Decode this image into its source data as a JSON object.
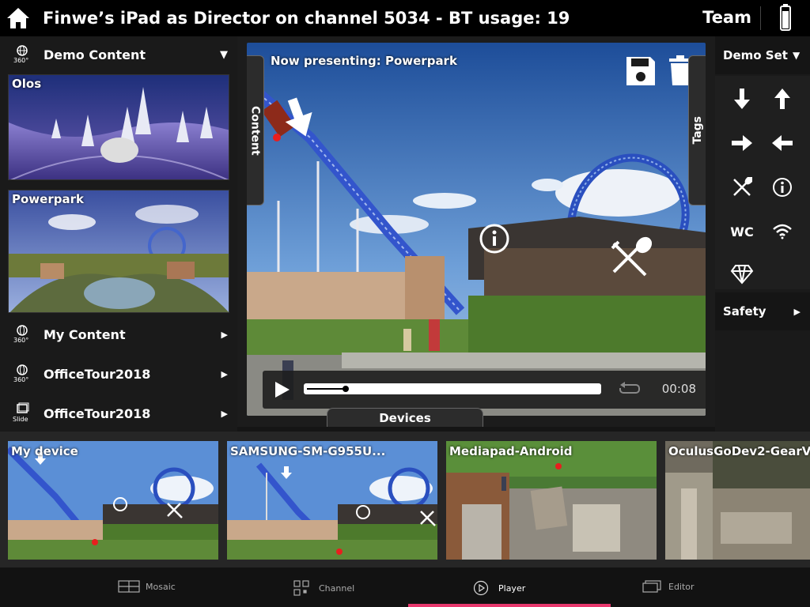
{
  "header": {
    "title": "Finwe’s iPad as Director on channel 5034 - BT usage: 19",
    "team_label": "Team"
  },
  "left_panel": {
    "demo_section": {
      "label": "Demo Content",
      "badge": "360°"
    },
    "thumbnails": [
      {
        "title": "Olos"
      },
      {
        "title": "Powerpark"
      }
    ],
    "sections": [
      {
        "label": "My Content",
        "badge": "360°"
      },
      {
        "label": "OfficeTour2018",
        "badge": "360°"
      },
      {
        "label": "OfficeTour2018",
        "badge": "Slide"
      }
    ]
  },
  "player": {
    "now_presenting": "Now presenting: Powerpark",
    "content_tab": "Content",
    "tags_tab": "Tags",
    "devices_tab": "Devices",
    "time": "00:08",
    "progress_fraction": 0.13
  },
  "right_panel": {
    "demo_set_label": "Demo Set",
    "safety_label": "Safety",
    "tags": [
      "arrow-down-icon",
      "arrow-up-icon",
      "arrow-right-icon",
      "arrow-left-icon",
      "restaurant-icon",
      "info-icon",
      "wc-icon",
      "wifi-icon",
      "diamond-icon"
    ],
    "wc_text": "WC"
  },
  "devices": [
    {
      "name": "My device"
    },
    {
      "name": "SAMSUNG-SM-G955U..."
    },
    {
      "name": "Mediapad-Android"
    },
    {
      "name": "OculusGoDev2-GearV"
    }
  ],
  "nav": {
    "items": [
      {
        "label": "Mosaic"
      },
      {
        "label": "Channel"
      },
      {
        "label": "Player"
      },
      {
        "label": "Editor"
      }
    ],
    "active": "Player",
    "accent": "#e8386d"
  }
}
